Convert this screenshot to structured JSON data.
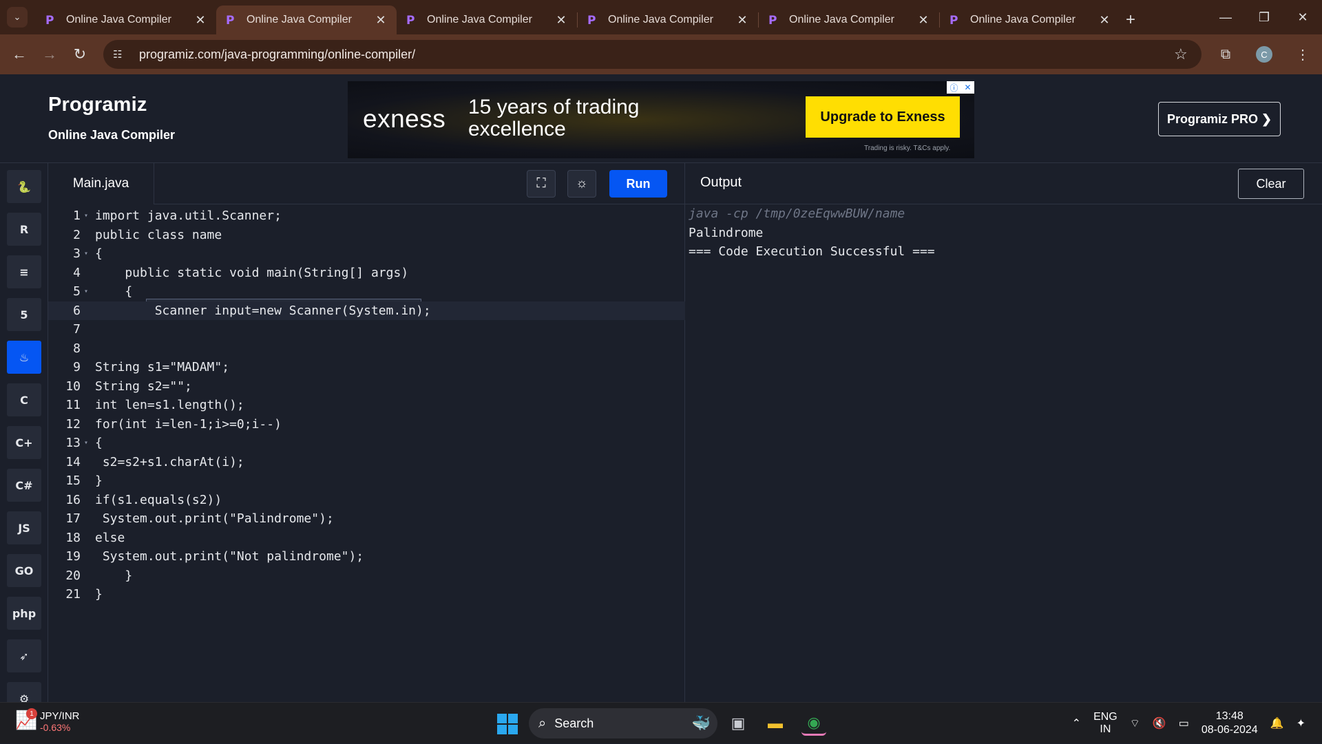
{
  "browser": {
    "tabs": [
      {
        "title": "Online Java Compiler",
        "active": false
      },
      {
        "title": "Online Java Compiler",
        "active": true
      },
      {
        "title": "Online Java Compiler",
        "active": false
      },
      {
        "title": "Online Java Compiler",
        "active": false
      },
      {
        "title": "Online Java Compiler",
        "active": false
      },
      {
        "title": "Online Java Compiler",
        "active": false
      }
    ],
    "url": "programiz.com/java-programming/online-compiler/",
    "profile_initial": "C"
  },
  "site": {
    "logo": "Programiz",
    "subtitle": "Online Java Compiler",
    "pro_button": "Programiz PRO ❯"
  },
  "ad": {
    "brand": "exness",
    "headline": "15 years of trading excellence",
    "cta": "Upgrade to Exness",
    "disclaimer": "Trading is risky. T&Cs apply."
  },
  "languages": [
    {
      "name": "python-icon",
      "glyph": "🐍",
      "active": false
    },
    {
      "name": "r-icon",
      "glyph": "R",
      "active": false
    },
    {
      "name": "sql-icon",
      "glyph": "≡",
      "active": false
    },
    {
      "name": "html-icon",
      "glyph": "5",
      "active": false
    },
    {
      "name": "java-icon",
      "glyph": "♨",
      "active": true
    },
    {
      "name": "c-icon",
      "glyph": "C",
      "active": false
    },
    {
      "name": "cpp-icon",
      "glyph": "C+",
      "active": false
    },
    {
      "name": "csharp-icon",
      "glyph": "C#",
      "active": false
    },
    {
      "name": "javascript-icon",
      "glyph": "JS",
      "active": false
    },
    {
      "name": "go-icon",
      "glyph": "GO",
      "active": false
    },
    {
      "name": "php-icon",
      "glyph": "php",
      "active": false
    },
    {
      "name": "swift-icon",
      "glyph": "➶",
      "active": false
    },
    {
      "name": "rust-icon",
      "glyph": "⚙",
      "active": false
    }
  ],
  "editor": {
    "file_name": "Main.java",
    "run_label": "Run",
    "lines": [
      {
        "n": "1",
        "fold": true,
        "text": "import java.util.Scanner;"
      },
      {
        "n": "2",
        "fold": false,
        "text": "public class name"
      },
      {
        "n": "3",
        "fold": true,
        "text": "{"
      },
      {
        "n": "4",
        "fold": false,
        "text": "    public static void main(String[] args)"
      },
      {
        "n": "5",
        "fold": true,
        "text": "    {"
      },
      {
        "n": "6",
        "fold": false,
        "text": "        Scanner input=new Scanner(System.in);",
        "current": true
      },
      {
        "n": "7",
        "fold": false,
        "text": ""
      },
      {
        "n": "8",
        "fold": false,
        "text": ""
      },
      {
        "n": "9",
        "fold": false,
        "text": "String s1=\"MADAM\";"
      },
      {
        "n": "10",
        "fold": false,
        "text": "String s2=\"\";"
      },
      {
        "n": "11",
        "fold": false,
        "text": "int len=s1.length();"
      },
      {
        "n": "12",
        "fold": false,
        "text": "for(int i=len-1;i>=0;i--)"
      },
      {
        "n": "13",
        "fold": true,
        "text": "{"
      },
      {
        "n": "14",
        "fold": false,
        "text": " s2=s2+s1.charAt(i);"
      },
      {
        "n": "15",
        "fold": false,
        "text": "}"
      },
      {
        "n": "16",
        "fold": false,
        "text": "if(s1.equals(s2))"
      },
      {
        "n": "17",
        "fold": false,
        "text": " System.out.print(\"Palindrome\");"
      },
      {
        "n": "18",
        "fold": false,
        "text": "else"
      },
      {
        "n": "19",
        "fold": false,
        "text": " System.out.print(\"Not palindrome\");"
      },
      {
        "n": "20",
        "fold": false,
        "text": "    }"
      },
      {
        "n": "21",
        "fold": false,
        "text": "}"
      }
    ]
  },
  "output": {
    "title": "Output",
    "clear_label": "Clear",
    "lines": [
      "java -cp /tmp/0zeEqwwBUW/name",
      "Palindrome",
      "=== Code Execution Successful ==="
    ]
  },
  "taskbar": {
    "ticker_symbol": "JPY/INR",
    "ticker_change": "-0.63%",
    "ticker_badge": "1",
    "search_label": "Search",
    "lang_line1": "ENG",
    "lang_line2": "IN",
    "time": "13:48",
    "date": "08-06-2024"
  }
}
